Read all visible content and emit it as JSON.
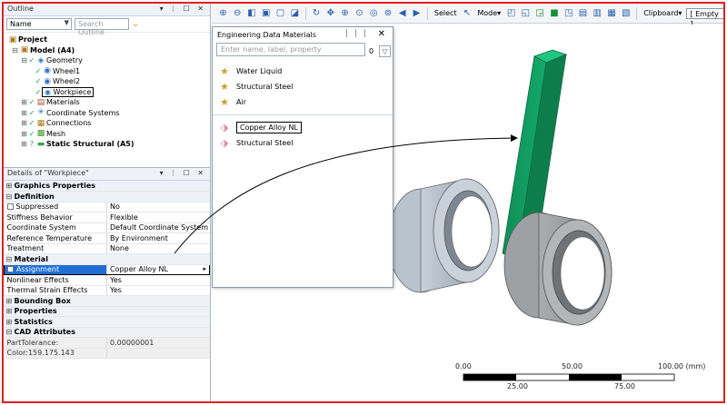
{
  "outline": {
    "title": "Outline",
    "title_controls": "▾ ᛁ ☐ ✕",
    "name_select": "Name",
    "search_placeholder": "Search Outline",
    "tree": [
      {
        "label": "Project",
        "level": 0,
        "bold": true
      },
      {
        "label": "Model (A4)",
        "level": 1,
        "bold": true
      },
      {
        "label": "Geometry",
        "level": 2
      },
      {
        "label": "Wheel1",
        "level": 3
      },
      {
        "label": "Wheel2",
        "level": 3
      },
      {
        "label": "Workpiece",
        "level": 3,
        "highlight": true
      },
      {
        "label": "Materials",
        "level": 2
      },
      {
        "label": "Coordinate Systems",
        "level": 2
      },
      {
        "label": "Connections",
        "level": 2
      },
      {
        "label": "Mesh",
        "level": 2
      },
      {
        "label": "Static Structural (A5)",
        "level": 2,
        "bold": true
      }
    ]
  },
  "details": {
    "title": "Details of \"Workpiece\"",
    "title_controls": "▾ ᛁ ☐ ✕",
    "sections": {
      "graphics": "Graphics Properties",
      "definition": "Definition",
      "material": "Material",
      "bounding_box": "Bounding Box",
      "properties": "Properties",
      "statistics": "Statistics",
      "cad": "CAD Attributes"
    },
    "definition_rows": [
      {
        "key": "Suppressed",
        "value": "No"
      },
      {
        "key": "Stiffness Behavior",
        "value": "Flexible"
      },
      {
        "key": "Coordinate System",
        "value": "Default Coordinate System"
      },
      {
        "key": "Reference Temperature",
        "value": "By Environment"
      },
      {
        "key": "Treatment",
        "value": "None"
      }
    ],
    "material_rows": {
      "assignment_key": "Assignment",
      "assignment_value": "Copper Alloy NL",
      "nonlinear_key": "Nonlinear Effects",
      "nonlinear_value": "Yes",
      "thermal_key": "Thermal Strain Effects",
      "thermal_value": "Yes"
    },
    "cad_rows": {
      "part_tol_key": "PartTolerance:",
      "part_tol_value": "0.00000001",
      "color": "Color:159.175.143"
    }
  },
  "toolbar": {
    "select_label": "Select",
    "mode_label": "Mode▾",
    "clipboard_label": "Clipboard▾",
    "empty_label": "[ Empty ]"
  },
  "materials_popup": {
    "title": "Engineering Data Materials",
    "title_controls": "ᛁᛁᛁ ✕",
    "search_placeholder": "Enter name, label, property",
    "count": "0",
    "favorites": [
      {
        "label": "Water Liquid"
      },
      {
        "label": "Structural Steel"
      },
      {
        "label": "Air"
      }
    ],
    "project": [
      {
        "label": "Copper Alloy NL",
        "highlight": true
      },
      {
        "label": "Structural Steel"
      }
    ]
  },
  "scale_bar": {
    "top_labels": [
      "0.00",
      "50.00",
      "100.00 (mm)"
    ],
    "bottom_labels": [
      "25.00",
      "75.00"
    ]
  },
  "colors": {
    "frame_red": "#e02020",
    "selection_blue": "#1f6fd6",
    "workpiece_green": "#169b62",
    "wheel_grey": "#a9acad"
  }
}
